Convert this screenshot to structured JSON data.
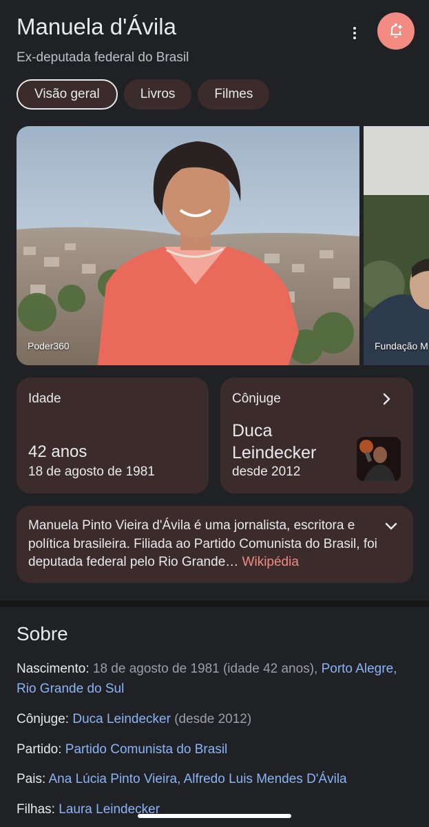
{
  "header": {
    "title": "Manuela d'Ávila",
    "subtitle": "Ex-deputada federal do Brasil",
    "more_icon": "more-vert-icon",
    "bell_icon": "add-alert-icon",
    "accent_color": "#f28b82"
  },
  "chips": [
    {
      "label": "Visão geral",
      "active": true
    },
    {
      "label": "Livros",
      "active": false
    },
    {
      "label": "Filmes",
      "active": false
    }
  ],
  "gallery": {
    "images": [
      {
        "source": "Poder360"
      },
      {
        "source": "Fundação M"
      }
    ]
  },
  "age_card": {
    "label": "Idade",
    "value": "42 anos",
    "date": "18 de agosto de 1981"
  },
  "spouse_card": {
    "label": "Cônjuge",
    "name": "Duca Leindecker",
    "since": "desde 2012"
  },
  "description": {
    "text": "Manuela Pinto Vieira d'Ávila é uma jornalista, escritora e política brasileira. Filiada ao Partido Comunista do Brasil, foi deputada federal pelo Rio Grande… ",
    "source": "Wikipédia"
  },
  "about": {
    "title": "Sobre",
    "birth_label": "Nascimento: ",
    "birth_value": "18 de agosto de 1981 (idade 42 anos), ",
    "birth_link": "Porto Alegre, Rio Grande do Sul",
    "spouse_label": "Cônjuge: ",
    "spouse_link": "Duca Leindecker",
    "spouse_value": " (desde 2012)",
    "party_label": "Partido: ",
    "party_link": "Partido Comunista do Brasil",
    "parents_label": "Pais: ",
    "parents_link": "Ana Lúcia Pinto Vieira, Alfredo Luis Mendes D'Ávila",
    "children_label": "Filhas: ",
    "children_link": "Laura Leindecker"
  }
}
